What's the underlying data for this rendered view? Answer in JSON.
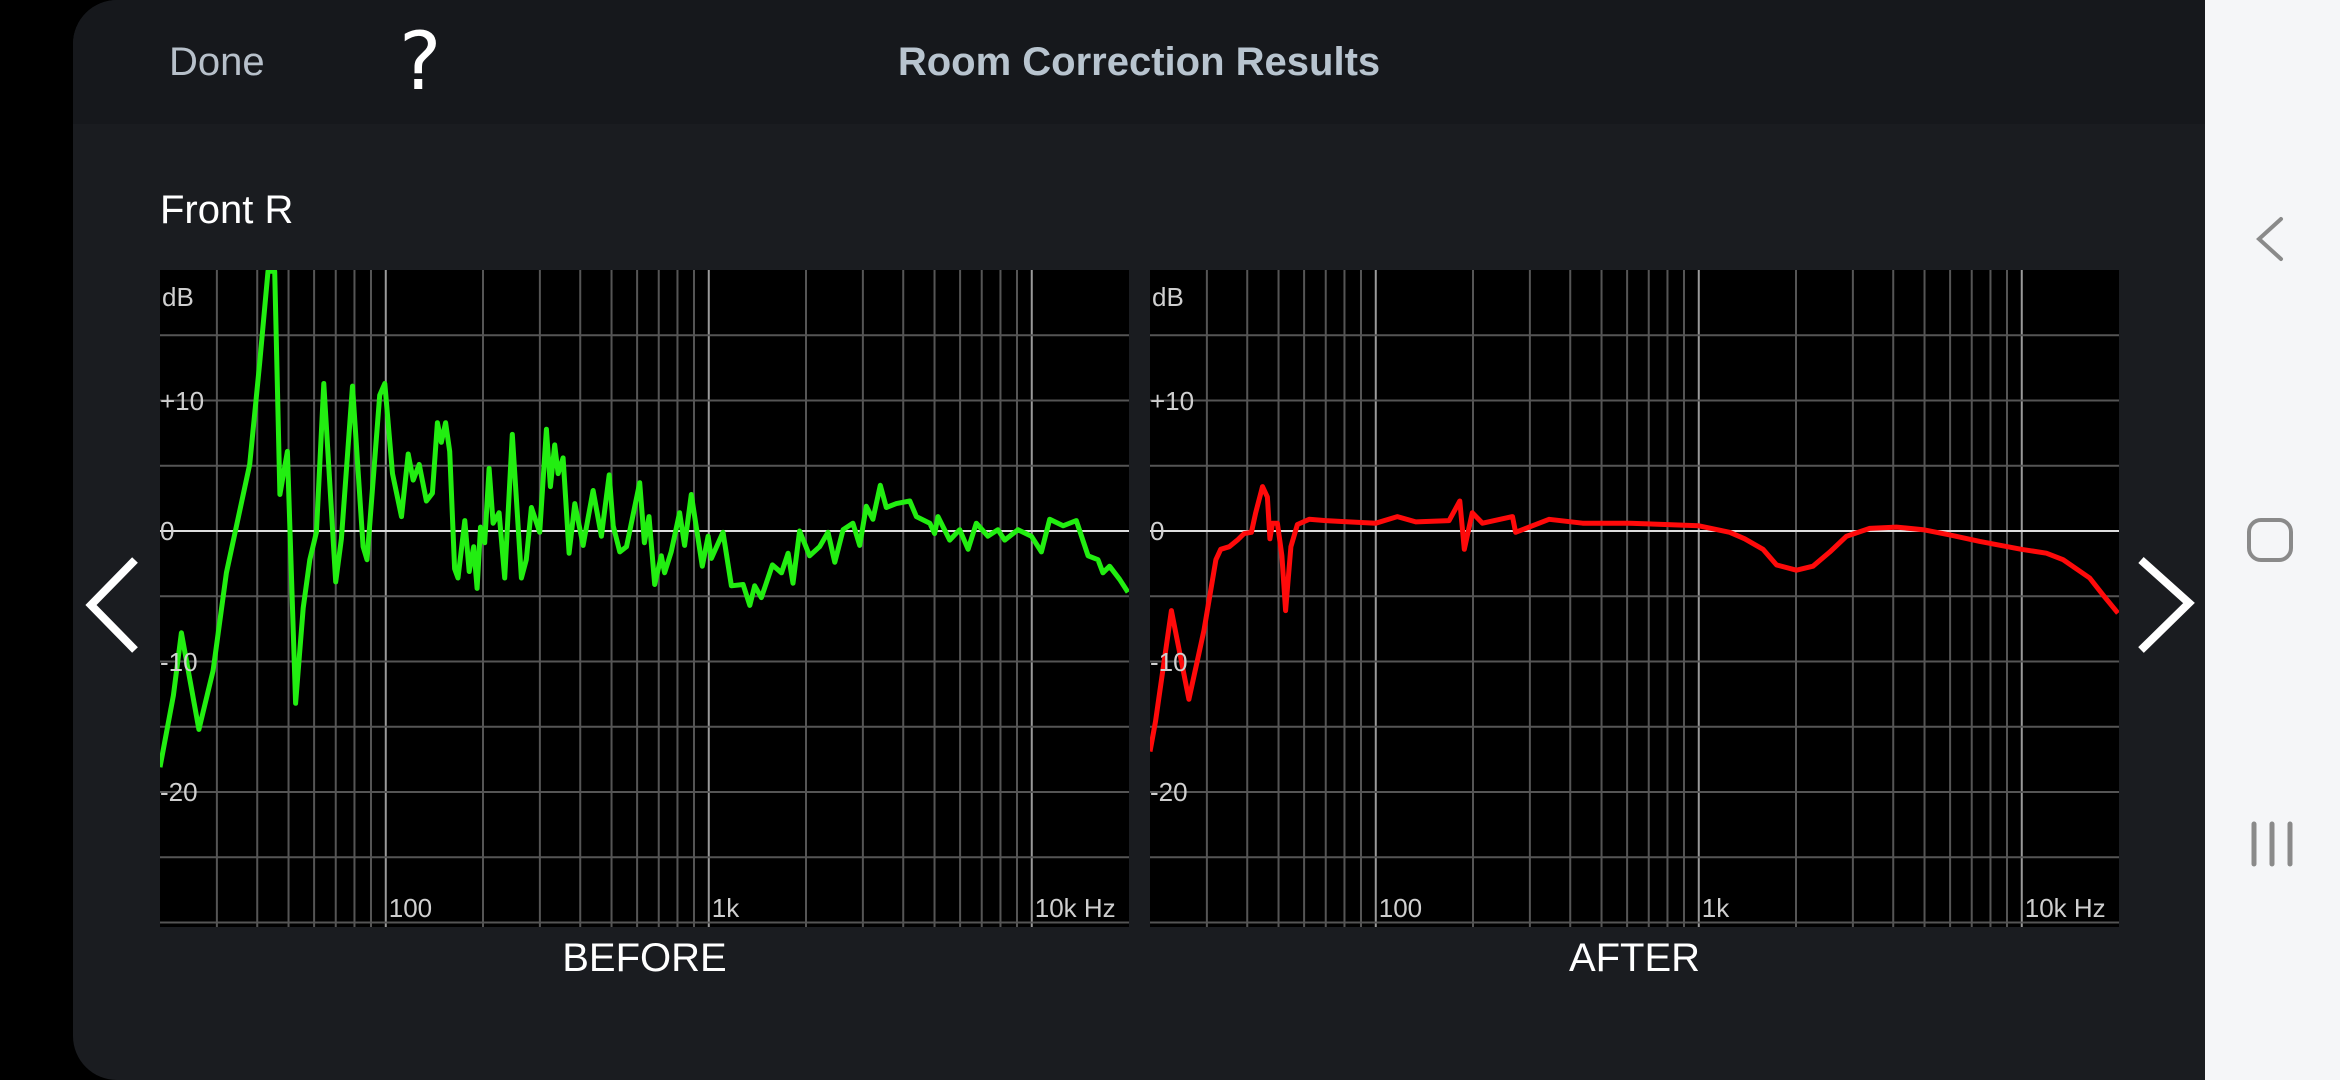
{
  "header": {
    "done_label": "Done",
    "help_label": "?",
    "title": "Room Correction Results"
  },
  "channel": "Front R",
  "chart_data": [
    {
      "type": "line",
      "title": "BEFORE",
      "xscale": "log",
      "xlim": [
        20,
        20000
      ],
      "ylim": [
        -30,
        20
      ],
      "ylabel": "dB",
      "yticks": [
        {
          "v": 10,
          "label": "+10"
        },
        {
          "v": 0,
          "label": "0"
        },
        {
          "v": -10,
          "label": "-10"
        },
        {
          "v": -20,
          "label": "-20"
        }
      ],
      "xticks": [
        {
          "v": 100,
          "label": "100"
        },
        {
          "v": 1000,
          "label": "1k"
        },
        {
          "v": 10000,
          "label": "10k Hz"
        }
      ],
      "grid": true,
      "color": "#22ee11",
      "points": [
        [
          20,
          -18.1
        ],
        [
          22,
          -12.6
        ],
        [
          23.3,
          -7.8
        ],
        [
          26.4,
          -15.2
        ],
        [
          29.2,
          -10.7
        ],
        [
          32.1,
          -3.2
        ],
        [
          37.9,
          5.1
        ],
        [
          40.7,
          12.9
        ],
        [
          43.2,
          19.9
        ],
        [
          45.3,
          19.9
        ],
        [
          47,
          2.8
        ],
        [
          49.6,
          6.1
        ],
        [
          52.6,
          -13.2
        ],
        [
          55.5,
          -5.9
        ],
        [
          58.2,
          -2.2
        ],
        [
          61,
          -0.1
        ],
        [
          64.3,
          11.3
        ],
        [
          70,
          -3.9
        ],
        [
          72.9,
          -0.6
        ],
        [
          78.9,
          11.1
        ],
        [
          85.1,
          -1.2
        ],
        [
          87.5,
          -2.2
        ],
        [
          95.8,
          10.4
        ],
        [
          99.3,
          11.3
        ],
        [
          104.9,
          4.4
        ],
        [
          111.9,
          1.1
        ],
        [
          117.3,
          5.9
        ],
        [
          121.6,
          3.9
        ],
        [
          126.9,
          5.1
        ],
        [
          133.6,
          2.3
        ],
        [
          139.4,
          2.9
        ],
        [
          144.5,
          8.3
        ],
        [
          148.6,
          6.8
        ],
        [
          153.2,
          8.3
        ],
        [
          157.7,
          6.1
        ],
        [
          163.3,
          -2.9
        ],
        [
          167.3,
          -3.6
        ],
        [
          175.7,
          0.8
        ],
        [
          181.2,
          -3.1
        ],
        [
          187.2,
          -1.2
        ],
        [
          191.7,
          -4.4
        ],
        [
          196.4,
          0.3
        ],
        [
          202.5,
          -0.9
        ],
        [
          208.9,
          4.8
        ],
        [
          215,
          0.6
        ],
        [
          224.4,
          1.4
        ],
        [
          233.5,
          -3.6
        ],
        [
          246.5,
          7.4
        ],
        [
          263,
          -3.6
        ],
        [
          272.3,
          -2.2
        ],
        [
          282.4,
          1.8
        ],
        [
          299.7,
          -0.1
        ],
        [
          314.2,
          7.8
        ],
        [
          323.4,
          3.4
        ],
        [
          333.5,
          6.6
        ],
        [
          341.7,
          4.4
        ],
        [
          354,
          5.6
        ],
        [
          369.5,
          -1.7
        ],
        [
          384.8,
          2.1
        ],
        [
          408.3,
          -1.1
        ],
        [
          438.5,
          3.1
        ],
        [
          465.3,
          -0.4
        ],
        [
          491.8,
          4.3
        ],
        [
          505.9,
          0.4
        ],
        [
          530.3,
          -1.6
        ],
        [
          556.3,
          -1.2
        ],
        [
          611,
          3.7
        ],
        [
          632,
          -0.9
        ],
        [
          653,
          1.1
        ],
        [
          680,
          -4.1
        ],
        [
          713,
          -1.9
        ],
        [
          730,
          -3.2
        ],
        [
          765,
          -1.6
        ],
        [
          812,
          1.4
        ],
        [
          842,
          -1.1
        ],
        [
          883,
          2.8
        ],
        [
          955,
          -2.7
        ],
        [
          995,
          -0.4
        ],
        [
          1019,
          -2.1
        ],
        [
          1107,
          -0.1
        ],
        [
          1175,
          -4.2
        ],
        [
          1277,
          -4.1
        ],
        [
          1340,
          -5.7
        ],
        [
          1387,
          -4.2
        ],
        [
          1455,
          -5.1
        ],
        [
          1574,
          -2.6
        ],
        [
          1679,
          -3.2
        ],
        [
          1760,
          -1.7
        ],
        [
          1823,
          -4.0
        ],
        [
          1911,
          0
        ],
        [
          2052,
          -1.9
        ],
        [
          2204,
          -1.2
        ],
        [
          2339,
          -0.1
        ],
        [
          2455,
          -2.4
        ],
        [
          2605,
          0.1
        ],
        [
          2795,
          0.6
        ],
        [
          2932,
          -1.1
        ],
        [
          3075,
          1.9
        ],
        [
          3222,
          0.9
        ],
        [
          3396,
          3.5
        ],
        [
          3546,
          1.8
        ],
        [
          3810,
          2.1
        ],
        [
          4191,
          2.3
        ],
        [
          4393,
          1.1
        ],
        [
          4833,
          0.6
        ],
        [
          5003,
          -0.2
        ],
        [
          5126,
          1.1
        ],
        [
          5570,
          -0.7
        ],
        [
          5983,
          0.1
        ],
        [
          6351,
          -1.4
        ],
        [
          6734,
          0.6
        ],
        [
          7316,
          -0.4
        ],
        [
          7857,
          0.1
        ],
        [
          8244,
          -0.7
        ],
        [
          9064,
          0.1
        ],
        [
          9972,
          -0.4
        ],
        [
          10710,
          -1.6
        ],
        [
          11360,
          0.9
        ],
        [
          12500,
          0.4
        ],
        [
          13740,
          0.8
        ],
        [
          14940,
          -1.9
        ],
        [
          16040,
          -2.2
        ],
        [
          16610,
          -3.2
        ],
        [
          17420,
          -2.7
        ],
        [
          18710,
          -3.7
        ],
        [
          19860,
          -4.7
        ]
      ]
    },
    {
      "type": "line",
      "title": "AFTER",
      "xscale": "log",
      "xlim": [
        20,
        20000
      ],
      "ylim": [
        -30,
        20
      ],
      "ylabel": "dB",
      "yticks": [
        {
          "v": 10,
          "label": "+10"
        },
        {
          "v": 0,
          "label": "0"
        },
        {
          "v": -10,
          "label": "-10"
        },
        {
          "v": -20,
          "label": "-20"
        }
      ],
      "xticks": [
        {
          "v": 100,
          "label": "100"
        },
        {
          "v": 1000,
          "label": "1k"
        },
        {
          "v": 10000,
          "label": "10k Hz"
        }
      ],
      "grid": true,
      "color": "#ff0a0a",
      "points": [
        [
          20,
          -16.9
        ],
        [
          20.8,
          -14.6
        ],
        [
          23.3,
          -6.1
        ],
        [
          26.4,
          -12.9
        ],
        [
          29.4,
          -7.6
        ],
        [
          32,
          -2.2
        ],
        [
          33.1,
          -1.4
        ],
        [
          35.2,
          -1.2
        ],
        [
          37.3,
          -0.7
        ],
        [
          39.1,
          -0.2
        ],
        [
          41.2,
          -0.1
        ],
        [
          42.5,
          1.4
        ],
        [
          44.6,
          3.4
        ],
        [
          46.2,
          2.6
        ],
        [
          47,
          -0.6
        ],
        [
          47.9,
          0.6
        ],
        [
          49.6,
          0.6
        ],
        [
          51.2,
          -1.9
        ],
        [
          52.6,
          -6.1
        ],
        [
          54.6,
          -1.2
        ],
        [
          57.2,
          0.5
        ],
        [
          62.2,
          0.9
        ],
        [
          70,
          0.8
        ],
        [
          82.6,
          0.7
        ],
        [
          100,
          0.6
        ],
        [
          116.7,
          1.1
        ],
        [
          133,
          0.7
        ],
        [
          168.7,
          0.8
        ],
        [
          182,
          2.3
        ],
        [
          188,
          -1.4
        ],
        [
          199,
          1.4
        ],
        [
          214,
          0.6
        ],
        [
          265,
          1.1
        ],
        [
          271,
          -0.1
        ],
        [
          344,
          0.9
        ],
        [
          437,
          0.6
        ],
        [
          611,
          0.6
        ],
        [
          1000,
          0.4
        ],
        [
          1247,
          -0.1
        ],
        [
          1387,
          -0.6
        ],
        [
          1581,
          -1.4
        ],
        [
          1740,
          -2.6
        ],
        [
          2005,
          -3.0
        ],
        [
          2258,
          -2.7
        ],
        [
          2546,
          -1.6
        ],
        [
          2866,
          -0.4
        ],
        [
          3383,
          0.2
        ],
        [
          4090,
          0.3
        ],
        [
          4953,
          0.1
        ],
        [
          5985,
          -0.3
        ],
        [
          7413,
          -0.8
        ],
        [
          9970,
          -1.4
        ],
        [
          11920,
          -1.7
        ],
        [
          13430,
          -2.2
        ],
        [
          16230,
          -3.6
        ],
        [
          17850,
          -4.9
        ],
        [
          19860,
          -6.3
        ]
      ]
    }
  ],
  "nav": {
    "prev_icon": "chevron-left-icon",
    "next_icon": "chevron-right-icon"
  },
  "system_nav": {
    "back": "back-icon",
    "home": "home-icon",
    "recents": "recents-icon"
  }
}
